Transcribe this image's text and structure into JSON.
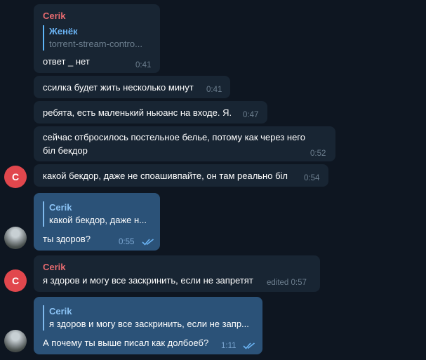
{
  "messages": [
    {
      "sender": "Cerik",
      "reply": {
        "name": "Женёк",
        "text": "torrent-stream-contro..."
      },
      "text": "ответ _ нет",
      "time": "0:41"
    },
    {
      "text": "ссилка будет жить несколько минут",
      "time": "0:41"
    },
    {
      "text": "ребята, есть маленький ньюанс на входе. Я.",
      "time": "0:47"
    },
    {
      "text_line1": "сейчас отбросилось постельное белье, потому как через него",
      "text_line2": "біл бекдор",
      "time": "0:52"
    },
    {
      "avatar": "C",
      "text": "какой бекдор, даже не споашивпайте, он там реально біл",
      "time": "0:54"
    },
    {
      "reply": {
        "name": "Cerik",
        "text": "какой бекдор, даже н..."
      },
      "text": "ты здоров?",
      "time": "0:55"
    },
    {
      "avatar": "C",
      "sender": "Cerik",
      "text": "я здоров и могу все заскринить, если не запретят",
      "time": "edited 0:57"
    },
    {
      "reply": {
        "name": "Cerik",
        "text": "я здоров и могу все заскринить, если не запр..."
      },
      "text": "А почему ты выше писал как долбоеб?",
      "time": "1:11"
    }
  ],
  "colors": {
    "background": "#0e1621",
    "incoming": "#182533",
    "outgoing": "#2b5278",
    "sender_name": "#e56a6f",
    "avatar": "#e1474d",
    "reply_accent": "#5eb5f7"
  },
  "icons": {
    "read_receipt": "double-check-icon"
  }
}
